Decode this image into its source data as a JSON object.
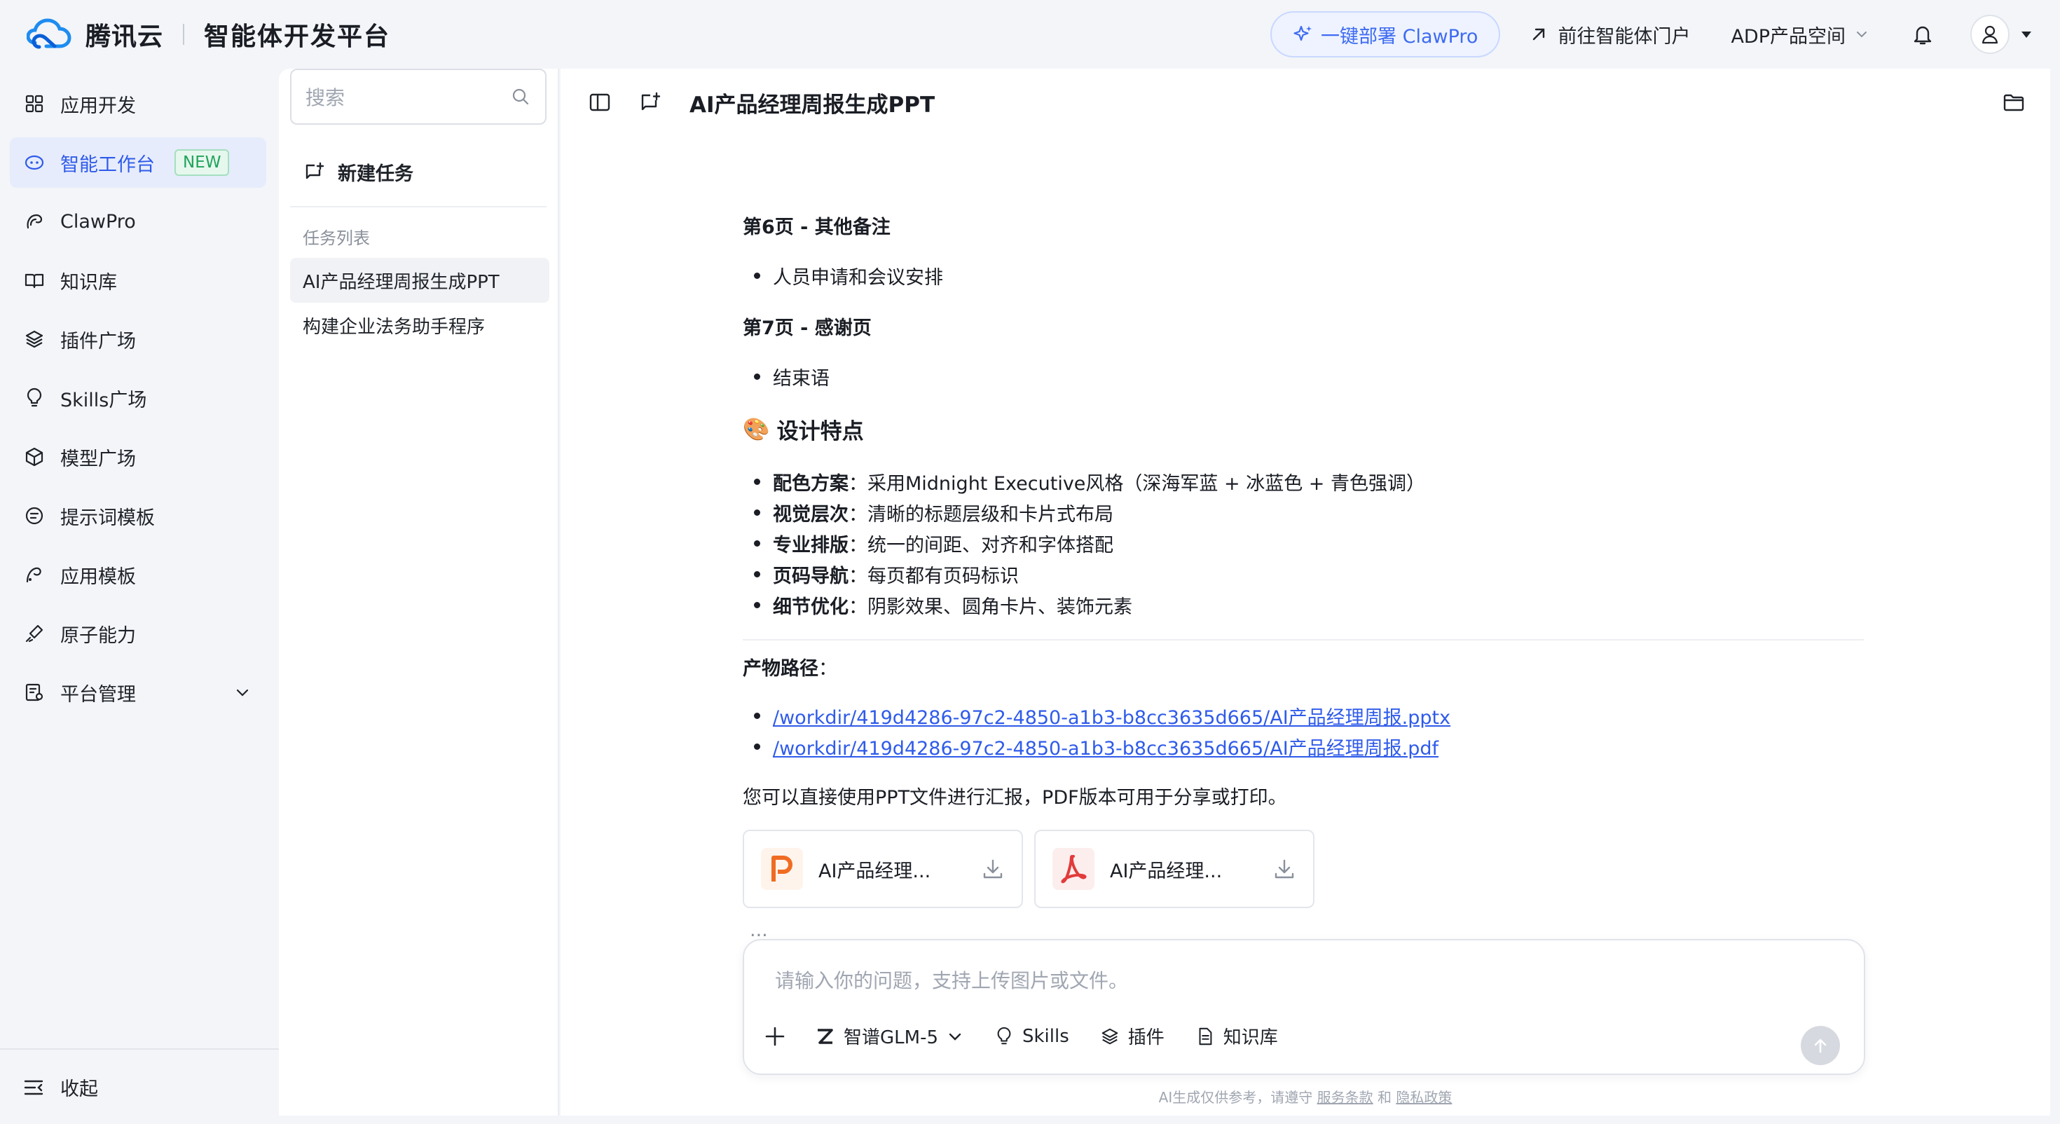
{
  "brand": {
    "name": "腾讯云",
    "product": "智能体开发平台"
  },
  "top": {
    "deploy_label": "一键部署 ClawPro",
    "portal_label": "前往智能体门户",
    "space_label": "ADP产品空间"
  },
  "sidebar": {
    "items": [
      {
        "label": "应用开发",
        "icon": "grid-icon"
      },
      {
        "label": "智能工作台",
        "icon": "workbench-icon",
        "badge": "NEW",
        "active": true
      },
      {
        "label": "ClawPro",
        "icon": "claw-icon"
      },
      {
        "label": "知识库",
        "icon": "book-icon"
      },
      {
        "label": "插件广场",
        "icon": "layers-icon"
      },
      {
        "label": "Skills广场",
        "icon": "bulb-icon"
      },
      {
        "label": "模型广场",
        "icon": "cube-icon"
      },
      {
        "label": "提示词模板",
        "icon": "prompt-icon"
      },
      {
        "label": "应用模板",
        "icon": "template-icon"
      },
      {
        "label": "原子能力",
        "icon": "atom-icon"
      },
      {
        "label": "平台管理",
        "icon": "manage-icon"
      }
    ],
    "collapse_label": "收起"
  },
  "tasks": {
    "search_placeholder": "搜索",
    "new_task_label": "新建任务",
    "section_label": "任务列表",
    "items": [
      "AI产品经理周报生成PPT",
      "构建企业法务助手程序"
    ]
  },
  "main": {
    "title": "AI产品经理周报生成PPT",
    "page6_title": "第6页 - 其他备注",
    "page6_bullet": "人员申请和会议安排",
    "page7_title": "第7页 - 感谢页",
    "page7_bullet": "结束语",
    "design_title": "设计特点",
    "design_emoji": "🎨",
    "features": [
      {
        "key": "配色方案",
        "value": "：采用Midnight Executive风格（深海军蓝 + 冰蓝色 + 青色强调）"
      },
      {
        "key": "视觉层次",
        "value": "：清晰的标题层级和卡片式布局"
      },
      {
        "key": "专业排版",
        "value": "：统一的间距、对齐和字体搭配"
      },
      {
        "key": "页码导航",
        "value": "：每页都有页码标识"
      },
      {
        "key": "细节优化",
        "value": "：阴影效果、圆角卡片、装饰元素"
      }
    ],
    "output_label": "产物路径",
    "output_colon": "：",
    "paths": [
      "/workdir/419d4286-97c2-4850-a1b3-b8cc3635d665/AI产品经理周报.pptx",
      "/workdir/419d4286-97c2-4850-a1b3-b8cc3635d665/AI产品经理周报.pdf"
    ],
    "closing": "您可以直接使用PPT文件进行汇报，PDF版本可用于分享或打印。",
    "files": [
      {
        "name": "AI产品经理...",
        "type": "pptx"
      },
      {
        "name": "AI产品经理...",
        "type": "pdf"
      }
    ],
    "ellipsis": "..."
  },
  "composer": {
    "placeholder": "请输入你的问题，支持上传图片或文件。",
    "model_label": "智谱GLM-5",
    "skills_label": "Skills",
    "plugins_label": "插件",
    "kb_label": "知识库"
  },
  "disclaimer": {
    "text": "AI生成仅供参考，请遵守",
    "terms": "服务条款",
    "and": "和",
    "privacy": "隐私政策"
  },
  "colors": {
    "accent": "#2f5bea",
    "new_badge": "#21a35a",
    "ppt_orange": "#f06c22",
    "pdf_red": "#e23b3b"
  }
}
